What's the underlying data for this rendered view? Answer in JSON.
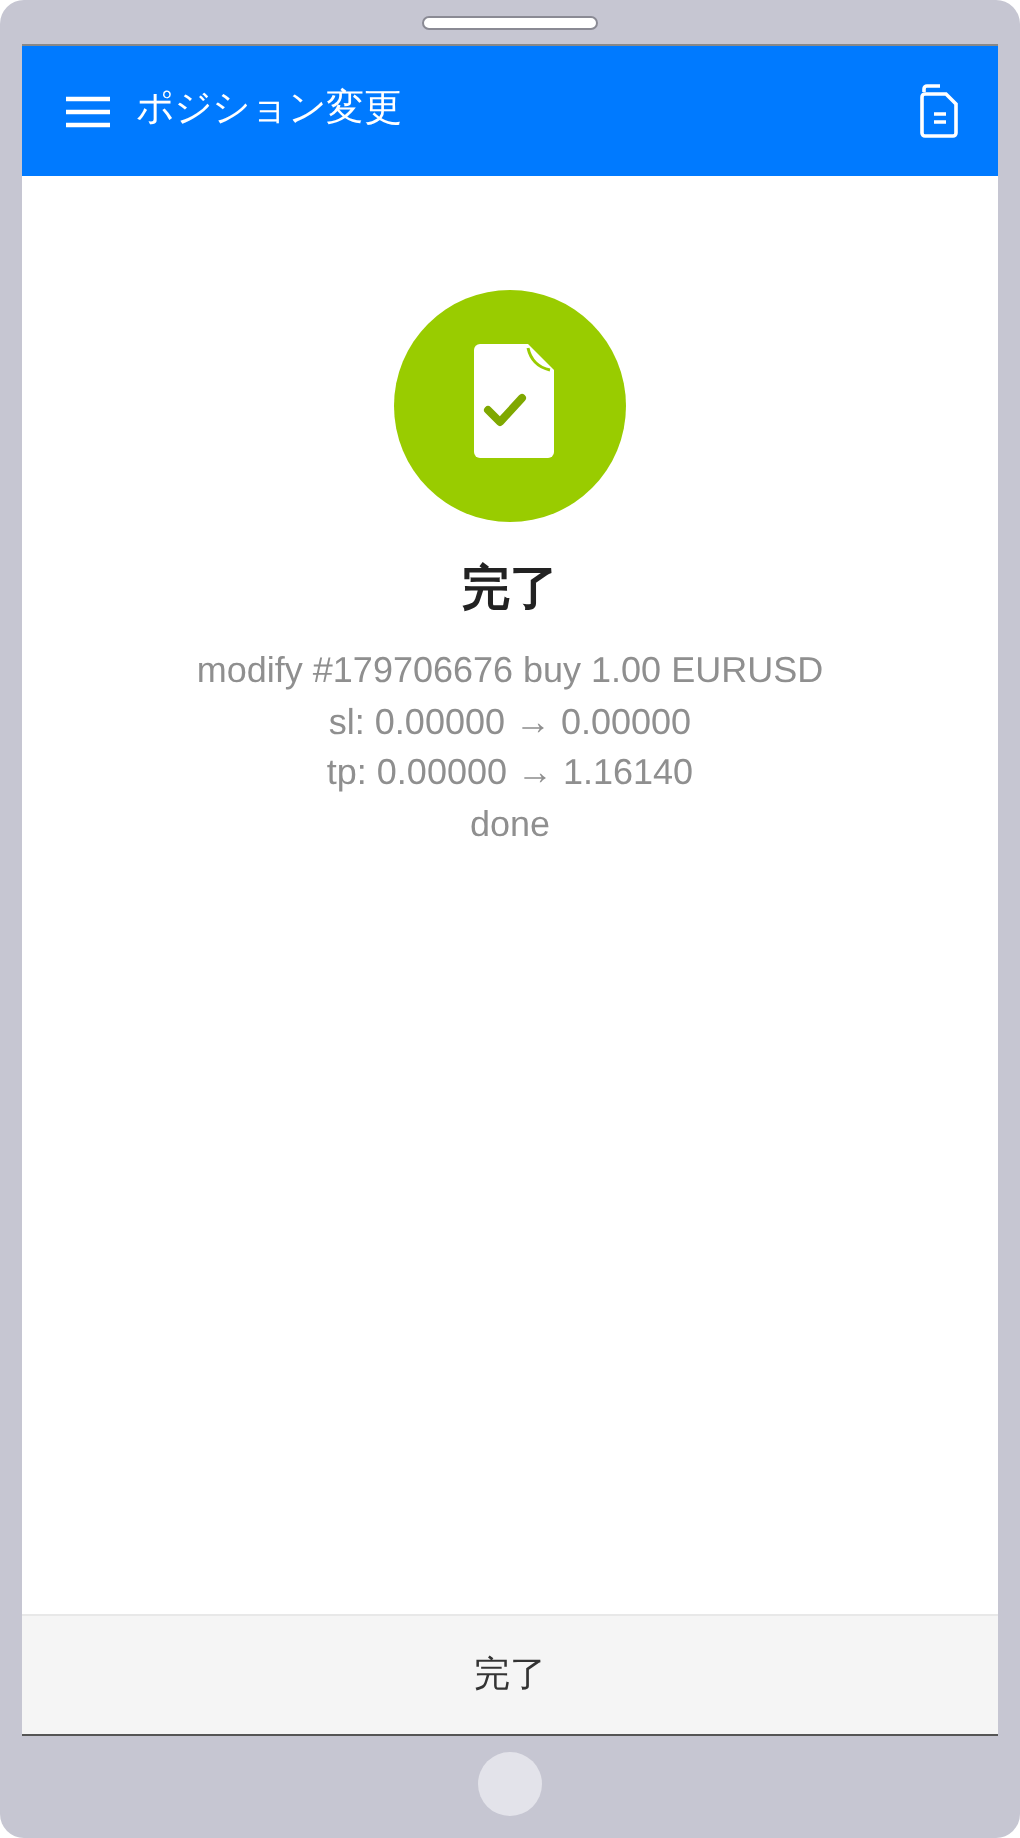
{
  "app_bar": {
    "title": "ポジション変更"
  },
  "result": {
    "title": "完了",
    "lines": [
      "modify #179706676 buy 1.00 EURUSD",
      "sl: 0.00000 → 0.00000",
      "tp: 0.00000 → 1.16140",
      "done"
    ]
  },
  "footer_button": {
    "label": "完了"
  }
}
